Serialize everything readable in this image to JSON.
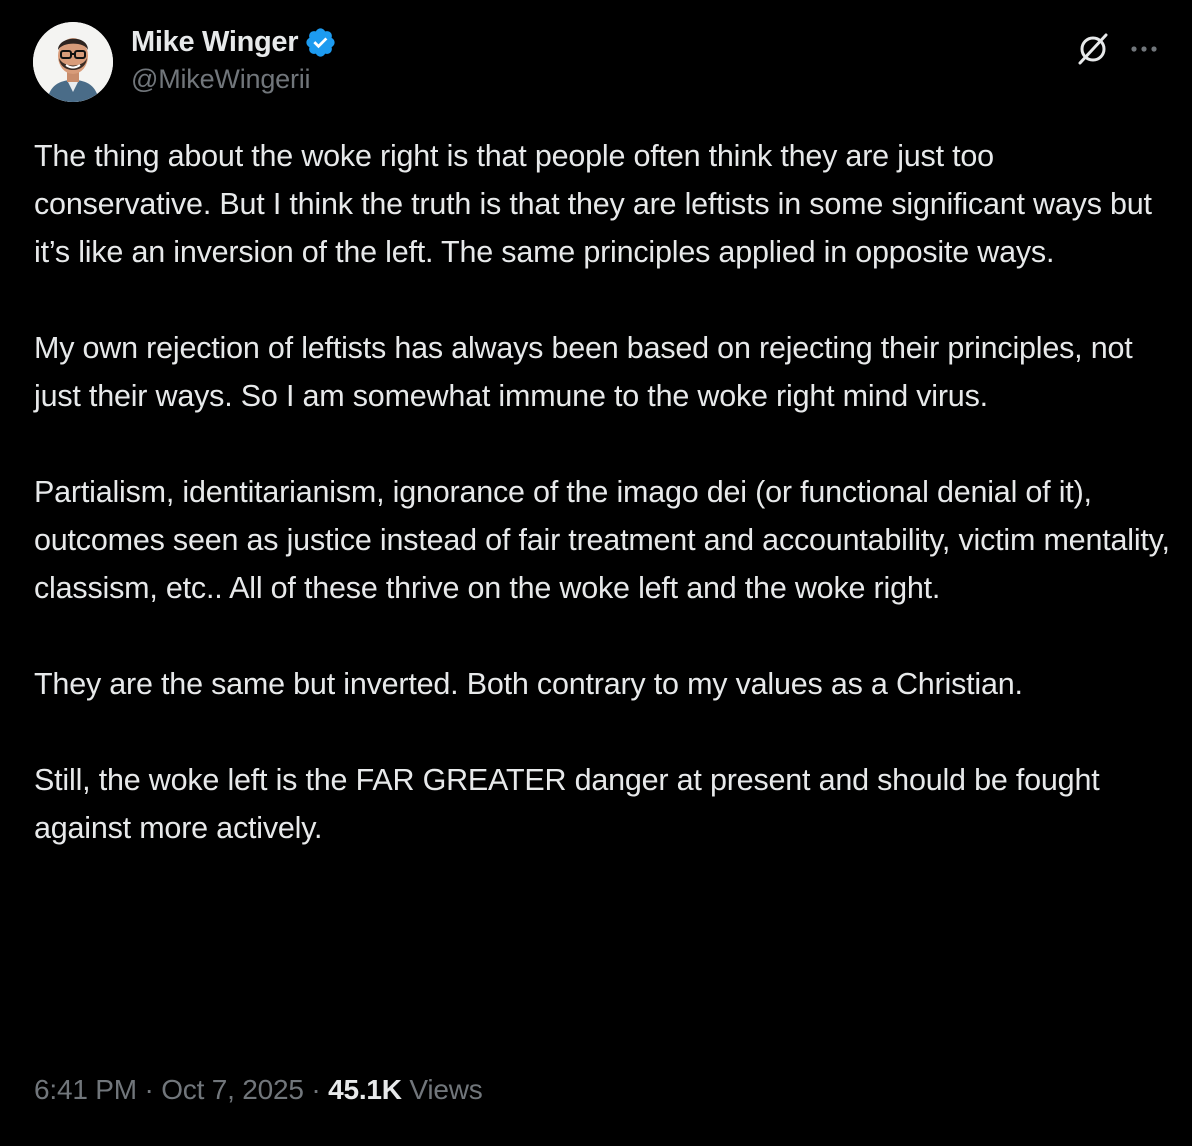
{
  "author": {
    "display_name": "Mike Winger",
    "handle": "@MikeWingerii",
    "verified": true,
    "verified_color": "#1d9bf0",
    "avatar_icon": "profile-photo"
  },
  "header_actions": {
    "grok_icon": "grok-icon",
    "more_icon": "more-icon"
  },
  "tweet": {
    "paragraphs": [
      "The thing about the woke right is that people often think they are just too conservative. But I think the truth is that they are leftists in some significant ways but it’s like an inversion of the left. The same principles applied in opposite ways.",
      "My own rejection of leftists has always been based on rejecting their principles, not just their ways. So I am somewhat immune to the woke right mind virus.",
      "Partialism, identitarianism, ignorance of the imago dei (or functional denial of it), outcomes seen as justice instead of fair treatment and accountability, victim mentality, classism, etc.. All of these thrive on the woke left and the woke right.",
      "They are the same but inverted. Both contrary to my values as a Christian.",
      "Still, the woke left is the FAR GREATER danger at present and should be fought against more actively."
    ]
  },
  "meta": {
    "time": "6:41 PM",
    "separator": "·",
    "date": "Oct 7, 2025",
    "views_count": "45.1K",
    "views_label": "Views"
  },
  "colors": {
    "background": "#000000",
    "text": "#e7e9ea",
    "secondary_text": "#71767b",
    "accent": "#1d9bf0"
  }
}
